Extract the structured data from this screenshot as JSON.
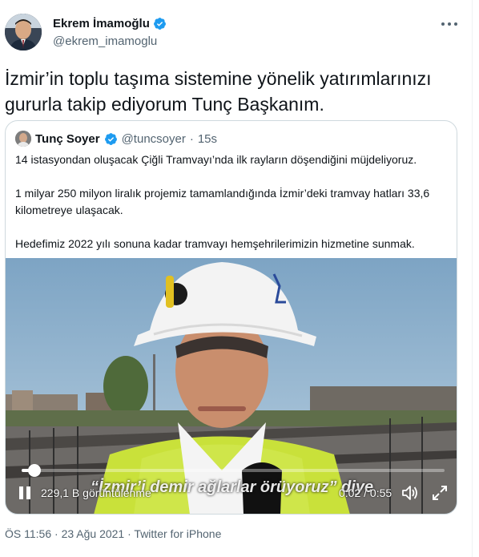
{
  "author": {
    "name": "Ekrem İmamoğlu",
    "handle": "@ekrem_imamoglu"
  },
  "tweet": {
    "text": "İzmir’in toplu taşıma sistemine yönelik yatırımlarınızı\ngururla takip ediyorum Tunç Başkanım."
  },
  "quote": {
    "name": "Tunç Soyer",
    "handle": "@tuncsoyer",
    "separator": "·",
    "time": "15s",
    "paragraphs": [
      "14 istasyondan oluşacak Çiğli Tramvayı’nda ilk rayların döşendiğini müjdeliyoruz.",
      "1 milyar 250 milyon liralık projemiz tamamlandığında İzmir’deki tramvay hatları 33,6 kilometreye ulaşacak.",
      "Hedefimiz 2022 yılı sonuna kadar tramvayı hemşehrilerimizin hizmetine sunmak."
    ]
  },
  "video": {
    "caption": "“İzmir’i demir ağlarlar örüyoruz” diye",
    "views": "229,1 B görüntülenme",
    "timecode": "0:02 / 0:55",
    "progress": 0.03,
    "icons": {
      "pause": "pause-icon",
      "volume": "volume-icon",
      "fullscreen": "fullscreen-icon"
    }
  },
  "meta": {
    "time": "ÖS 11:56",
    "separator": "·",
    "date": "23 Ağu 2021",
    "source": "Twitter for iPhone"
  },
  "colors": {
    "verified": "#1d9bf0",
    "secondary_text": "#536471",
    "border": "#cfd9de"
  }
}
